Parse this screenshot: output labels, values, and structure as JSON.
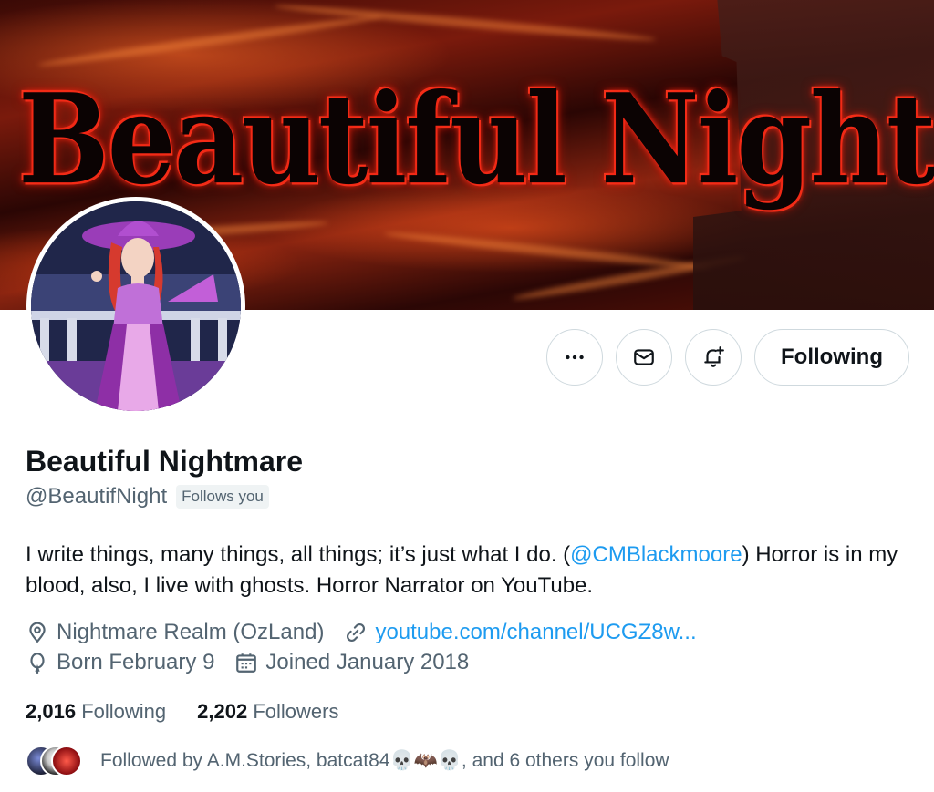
{
  "banner": {
    "title_art": "Beautiful Nightmare"
  },
  "profile": {
    "display_name": "Beautiful Nightmare",
    "handle": "@BeautifNight",
    "follows_you_badge": "Follows you"
  },
  "actions": {
    "more_icon": "more-icon",
    "message_icon": "envelope-icon",
    "notify_icon": "bell-plus-icon",
    "follow_label": "Following"
  },
  "bio": {
    "part1": "I write things, many things, all things; it’s just what I do. (",
    "mention": "@CMBlackmoore",
    "part2": ") Horror is in my blood, also, I live with ghosts. Horror Narrator on YouTube."
  },
  "meta": {
    "location": "Nightmare Realm (OzLand)",
    "website": "youtube.com/channel/UCGZ8w...",
    "birthday": "Born February 9",
    "joined": "Joined January 2018"
  },
  "stats": {
    "following_count": "2,016",
    "following_label": "Following",
    "followers_count": "2,202",
    "followers_label": "Followers"
  },
  "followed_by": {
    "text": "Followed by A.M.Stories, batcat84💀🦇💀, and 6 others you follow"
  },
  "colors": {
    "accent": "#1d9bf0",
    "secondary_text": "#536471",
    "primary_text": "#0f1419"
  }
}
